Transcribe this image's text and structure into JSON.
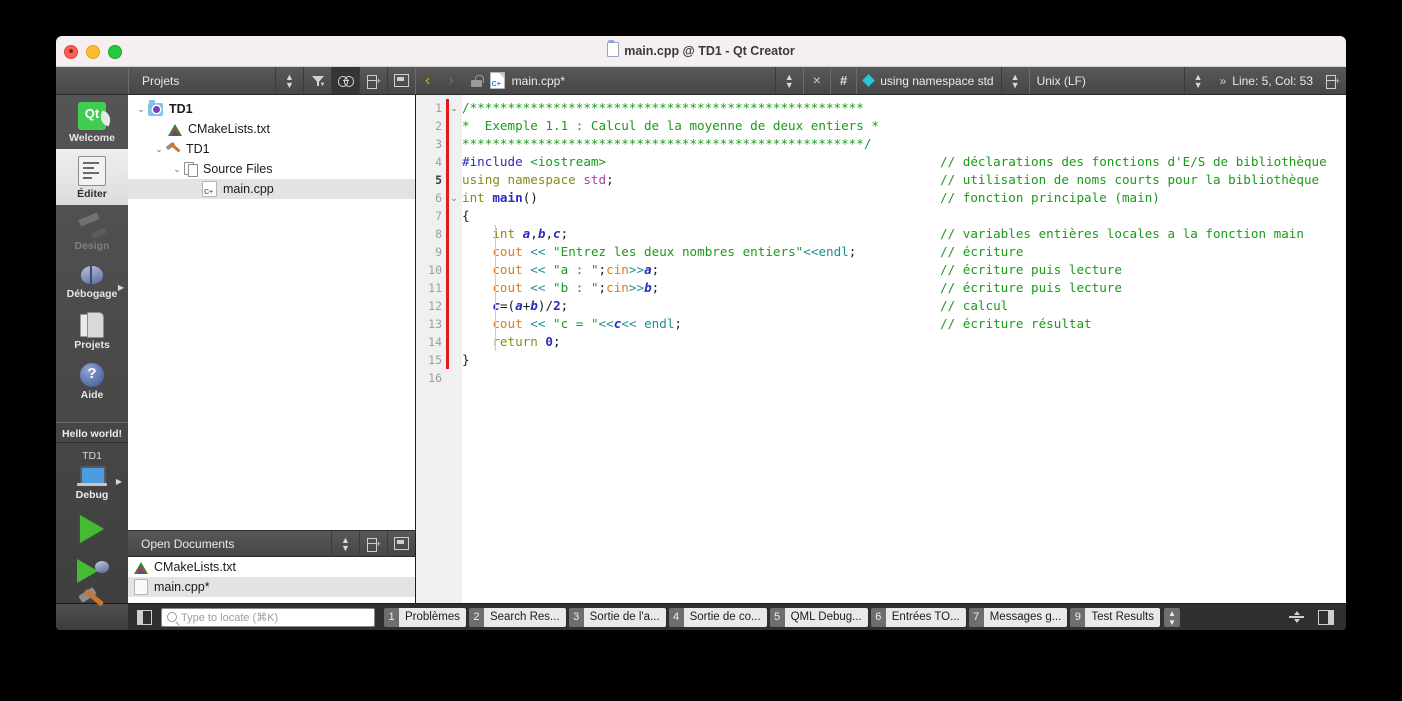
{
  "window": {
    "title": "main.cpp @ TD1 - Qt Creator",
    "traffic": {
      "close": "close-button",
      "minimize": "minimize-button",
      "zoom": "zoom-button"
    }
  },
  "toolbar": {
    "projects_label": "Projets",
    "back": "‹",
    "forward": "›",
    "filename": "main.cpp*",
    "symbol": "using namespace std",
    "line_ending": "Unix (LF)",
    "cursor_position": "Line: 5, Col: 53",
    "hash": "#",
    "close_x": "×",
    "chevrons": "»"
  },
  "modebar": {
    "items": [
      {
        "label": "Welcome",
        "icon": "qt-logo-icon",
        "state": "normal"
      },
      {
        "label": "Éditer",
        "icon": "editor-icon",
        "state": "selected"
      },
      {
        "label": "Design",
        "icon": "design-icon",
        "state": "disabled"
      },
      {
        "label": "Débogage",
        "icon": "bug-icon",
        "state": "normal"
      },
      {
        "label": "Projets",
        "icon": "folder-icon",
        "state": "normal"
      },
      {
        "label": "Aide",
        "icon": "help-icon",
        "state": "normal"
      }
    ],
    "kit": {
      "project_name": "Hello world!",
      "target": "TD1",
      "build_config": "Debug"
    },
    "actions": [
      {
        "name": "run-button",
        "icon": "play-triangle-icon"
      },
      {
        "name": "debug-button",
        "icon": "play-with-bug-icon"
      },
      {
        "name": "build-button",
        "icon": "hammer-icon"
      }
    ]
  },
  "projects_panel": {
    "title": "Projets",
    "tree": [
      {
        "label": "TD1",
        "icon": "project-folder-icon",
        "depth": 0,
        "caret": "⌄",
        "bold": true,
        "selected": false
      },
      {
        "label": "CMakeLists.txt",
        "icon": "cmake-icon",
        "depth": 1,
        "caret": "",
        "bold": false,
        "selected": false
      },
      {
        "label": "TD1",
        "icon": "build-target-icon",
        "depth": 1,
        "caret": "⌄",
        "bold": false,
        "selected": false
      },
      {
        "label": "Source Files",
        "icon": "files-icon",
        "depth": 2,
        "caret": "⌄",
        "bold": false,
        "selected": false
      },
      {
        "label": "main.cpp",
        "icon": "cpp-file-icon",
        "depth": 3,
        "caret": "",
        "bold": false,
        "selected": true
      }
    ]
  },
  "open_documents": {
    "title": "Open Documents",
    "items": [
      {
        "label": "CMakeLists.txt",
        "icon": "cmake-icon",
        "selected": false
      },
      {
        "label": "main.cpp*",
        "icon": "document-icon",
        "selected": true
      }
    ]
  },
  "editor": {
    "current_line": 5,
    "total_lines": 16,
    "modified_marker_lines": [
      1,
      15
    ],
    "fold_markers": [
      1,
      6
    ],
    "line_numbers": [
      1,
      2,
      3,
      4,
      5,
      6,
      7,
      8,
      9,
      10,
      11,
      12,
      13,
      14,
      15,
      16
    ],
    "code_lines": [
      {
        "n": 1,
        "tokens": [
          {
            "t": "/****************************************************",
            "c": "cmt"
          }
        ]
      },
      {
        "n": 2,
        "tokens": [
          {
            "t": "*  Exemple 1.1 : Calcul de la moyenne de deux entiers *",
            "c": "cmt"
          }
        ]
      },
      {
        "n": 3,
        "tokens": [
          {
            "t": "*****************************************************/",
            "c": "cmt"
          }
        ]
      },
      {
        "n": 4,
        "tokens": [
          {
            "t": "#include ",
            "c": "pre"
          },
          {
            "t": "<iostream>",
            "c": "inc"
          }
        ]
      },
      {
        "n": 5,
        "tokens": [
          {
            "t": "using namespace ",
            "c": "kw"
          },
          {
            "t": "std",
            "c": "ns"
          },
          {
            "t": ";",
            "c": ""
          }
        ]
      },
      {
        "n": 6,
        "tokens": [
          {
            "t": "int ",
            "c": "kw"
          },
          {
            "t": "main",
            "c": "fn"
          },
          {
            "t": "()",
            "c": ""
          }
        ]
      },
      {
        "n": 7,
        "tokens": [
          {
            "t": "{",
            "c": ""
          }
        ]
      },
      {
        "n": 8,
        "tokens": [
          {
            "t": "    int ",
            "c": "kw"
          },
          {
            "t": "a",
            "c": "var"
          },
          {
            "t": ",",
            "c": ""
          },
          {
            "t": "b",
            "c": "var"
          },
          {
            "t": ",",
            "c": ""
          },
          {
            "t": "c",
            "c": "var"
          },
          {
            "t": ";",
            "c": ""
          }
        ]
      },
      {
        "n": 9,
        "tokens": [
          {
            "t": "    ",
            "c": ""
          },
          {
            "t": "cout",
            "c": "io"
          },
          {
            "t": " ",
            "c": ""
          },
          {
            "t": "<<",
            "c": "op"
          },
          {
            "t": " ",
            "c": ""
          },
          {
            "t": "\"Entrez les deux nombres entiers\"",
            "c": "str"
          },
          {
            "t": "<<",
            "c": "op"
          },
          {
            "t": "endl",
            "c": "op"
          },
          {
            "t": ";",
            "c": ""
          }
        ]
      },
      {
        "n": 10,
        "tokens": [
          {
            "t": "    ",
            "c": ""
          },
          {
            "t": "cout",
            "c": "io"
          },
          {
            "t": " ",
            "c": ""
          },
          {
            "t": "<<",
            "c": "op"
          },
          {
            "t": " ",
            "c": ""
          },
          {
            "t": "\"a : \"",
            "c": "str"
          },
          {
            "t": ";",
            "c": ""
          },
          {
            "t": "cin",
            "c": "io"
          },
          {
            "t": ">>",
            "c": "op"
          },
          {
            "t": "a",
            "c": "var"
          },
          {
            "t": ";",
            "c": ""
          }
        ]
      },
      {
        "n": 11,
        "tokens": [
          {
            "t": "    ",
            "c": ""
          },
          {
            "t": "cout",
            "c": "io"
          },
          {
            "t": " ",
            "c": ""
          },
          {
            "t": "<<",
            "c": "op"
          },
          {
            "t": " ",
            "c": ""
          },
          {
            "t": "\"b : \"",
            "c": "str"
          },
          {
            "t": ";",
            "c": ""
          },
          {
            "t": "cin",
            "c": "io"
          },
          {
            "t": ">>",
            "c": "op"
          },
          {
            "t": "b",
            "c": "var"
          },
          {
            "t": ";",
            "c": ""
          }
        ]
      },
      {
        "n": 12,
        "tokens": [
          {
            "t": "    ",
            "c": ""
          },
          {
            "t": "c",
            "c": "var"
          },
          {
            "t": "=(",
            "c": ""
          },
          {
            "t": "a",
            "c": "var"
          },
          {
            "t": "+",
            "c": ""
          },
          {
            "t": "b",
            "c": "var"
          },
          {
            "t": ")/",
            "c": ""
          },
          {
            "t": "2",
            "c": "num"
          },
          {
            "t": ";",
            "c": ""
          }
        ]
      },
      {
        "n": 13,
        "tokens": [
          {
            "t": "    ",
            "c": ""
          },
          {
            "t": "cout",
            "c": "io"
          },
          {
            "t": " ",
            "c": ""
          },
          {
            "t": "<<",
            "c": "op"
          },
          {
            "t": " ",
            "c": ""
          },
          {
            "t": "\"c = \"",
            "c": "str"
          },
          {
            "t": "<<",
            "c": "op"
          },
          {
            "t": "c",
            "c": "var"
          },
          {
            "t": "<<",
            "c": "op"
          },
          {
            "t": " ",
            "c": ""
          },
          {
            "t": "endl",
            "c": "op"
          },
          {
            "t": ";",
            "c": ""
          }
        ]
      },
      {
        "n": 14,
        "tokens": [
          {
            "t": "    ",
            "c": ""
          },
          {
            "t": "return ",
            "c": "kw"
          },
          {
            "t": "0",
            "c": "num"
          },
          {
            "t": ";",
            "c": ""
          }
        ]
      },
      {
        "n": 15,
        "tokens": [
          {
            "t": "}",
            "c": ""
          }
        ]
      },
      {
        "n": 16,
        "tokens": []
      }
    ],
    "comments": [
      {
        "line": 4,
        "text": "// déclarations des fonctions d'E/S de bibliothèque"
      },
      {
        "line": 5,
        "text": "// utilisation de noms courts pour la bibliothèque"
      },
      {
        "line": 6,
        "text": "// fonction principale (main)"
      },
      {
        "line": 8,
        "text": "// variables entières locales a la fonction main"
      },
      {
        "line": 9,
        "text": "// écriture"
      },
      {
        "line": 10,
        "text": "// écriture puis lecture"
      },
      {
        "line": 11,
        "text": "// écriture puis lecture"
      },
      {
        "line": 12,
        "text": "// calcul"
      },
      {
        "line": 13,
        "text": "// écriture résultat"
      }
    ]
  },
  "statusbar": {
    "locate_placeholder": "Type to locate (⌘K)",
    "output_tabs": [
      {
        "num": "1",
        "label": "Problèmes"
      },
      {
        "num": "2",
        "label": "Search Res..."
      },
      {
        "num": "3",
        "label": "Sortie de l'a..."
      },
      {
        "num": "4",
        "label": "Sortie de co..."
      },
      {
        "num": "5",
        "label": "QML Debug..."
      },
      {
        "num": "6",
        "label": "Entrées TO..."
      },
      {
        "num": "7",
        "label": "Messages g..."
      },
      {
        "num": "9",
        "label": "Test Results"
      }
    ]
  },
  "colors": {
    "accent_qt_green": "#41cd52",
    "modified_marker": "#e01b1b",
    "comment_green": "#1a9a1a",
    "string_green": "#1a9a1a",
    "keyword_olive": "#8a8a14",
    "io_orange": "#e07a18",
    "operator_teal": "#1f8f8f",
    "variable_blue": "#2b2bbb",
    "namespace_magenta": "#b03bb0",
    "symbol_diamond_cyan": "#2ec4d6"
  }
}
